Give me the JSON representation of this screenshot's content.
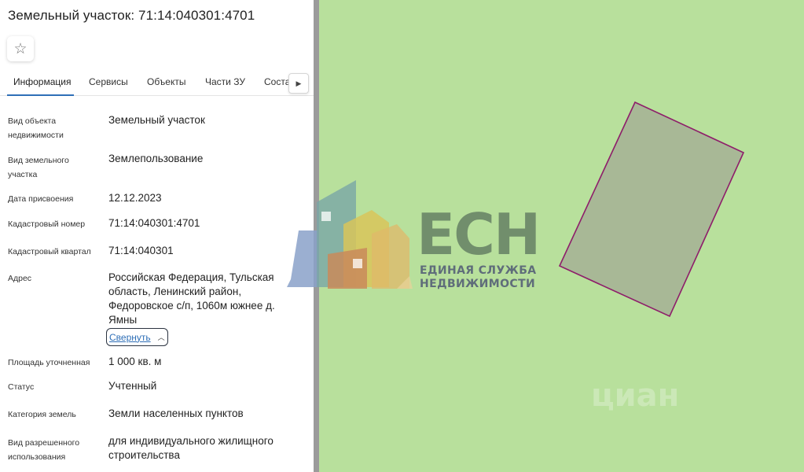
{
  "header": {
    "title": "Земельный участок: 71:14:040301:4701",
    "favorite_icon": "star-outline-icon"
  },
  "tabs": [
    {
      "label": "Информация",
      "active": true
    },
    {
      "label": "Сервисы",
      "active": false
    },
    {
      "label": "Объекты",
      "active": false
    },
    {
      "label": "Части ЗУ",
      "active": false
    },
    {
      "label": "Состав",
      "active": false
    }
  ],
  "tabs_scroll_icon": "caret-right-icon",
  "fields": {
    "object_type": {
      "label": "Вид объекта недвижимости",
      "value": "Земельный участок"
    },
    "land_kind": {
      "label": "Вид земельного участка",
      "value": "Землепользование"
    },
    "assign_date": {
      "label": "Дата присвоения",
      "value": "12.12.2023"
    },
    "cadastral_number": {
      "label": "Кадастровый номер",
      "value": "71:14:040301:4701"
    },
    "cadastral_block": {
      "label": "Кадастровый квартал",
      "value": "71:14:040301"
    },
    "address": {
      "label": "Адрес",
      "value": "Российская Федерация, Тульская область, Ленинский район, Федоровское с/п, 1060м южнее д. Ямны"
    },
    "area": {
      "label": "Площадь уточненная",
      "value": "1 000 кв. м"
    },
    "status": {
      "label": "Статус",
      "value": "Учтенный"
    },
    "land_category": {
      "label": "Категория земель",
      "value": "Земли населенных пунктов"
    },
    "permitted_use": {
      "label": "Вид разрешенного использования",
      "value": "для индивидуального жилищного строительства"
    }
  },
  "collapse": {
    "label": "Свернуть",
    "icon": "chevron-up-icon"
  },
  "logo": {
    "word": "ЕСН",
    "subtitle_line1": "ЕДИНАЯ СЛУЖБА",
    "subtitle_line2": "НЕДВИЖИМОСТИ"
  },
  "watermark": "циан",
  "colors": {
    "map_background": "#b8e09c",
    "parcel_fill": "#a8b896",
    "parcel_border": "#8e1e6a",
    "tab_accent": "#2f6fb7",
    "link": "#2f6fb7"
  }
}
